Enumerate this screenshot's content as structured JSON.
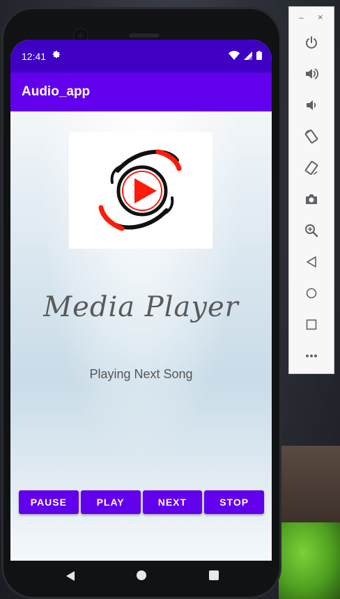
{
  "status_bar": {
    "time": "12:41"
  },
  "app_bar": {
    "title": "Audio_app"
  },
  "main": {
    "heading": "Media Player",
    "status": "Playing Next Song"
  },
  "controls": [
    {
      "label": "PAUSE"
    },
    {
      "label": "PLAY"
    },
    {
      "label": "NEXT"
    },
    {
      "label": "STOP"
    }
  ],
  "emulator_toolbar": {
    "minimize": "–",
    "close": "×",
    "tools": [
      "power-icon",
      "volume-up-icon",
      "volume-down-icon",
      "rotate-left-icon",
      "rotate-right-icon",
      "camera-icon",
      "zoom-icon",
      "back-icon",
      "home-icon",
      "overview-icon",
      "more-icon"
    ]
  },
  "colors": {
    "status_bar": "#3f00c4",
    "app_bar": "#6200ee",
    "button": "#6200ee",
    "logo_red": "#ff1a0a"
  }
}
